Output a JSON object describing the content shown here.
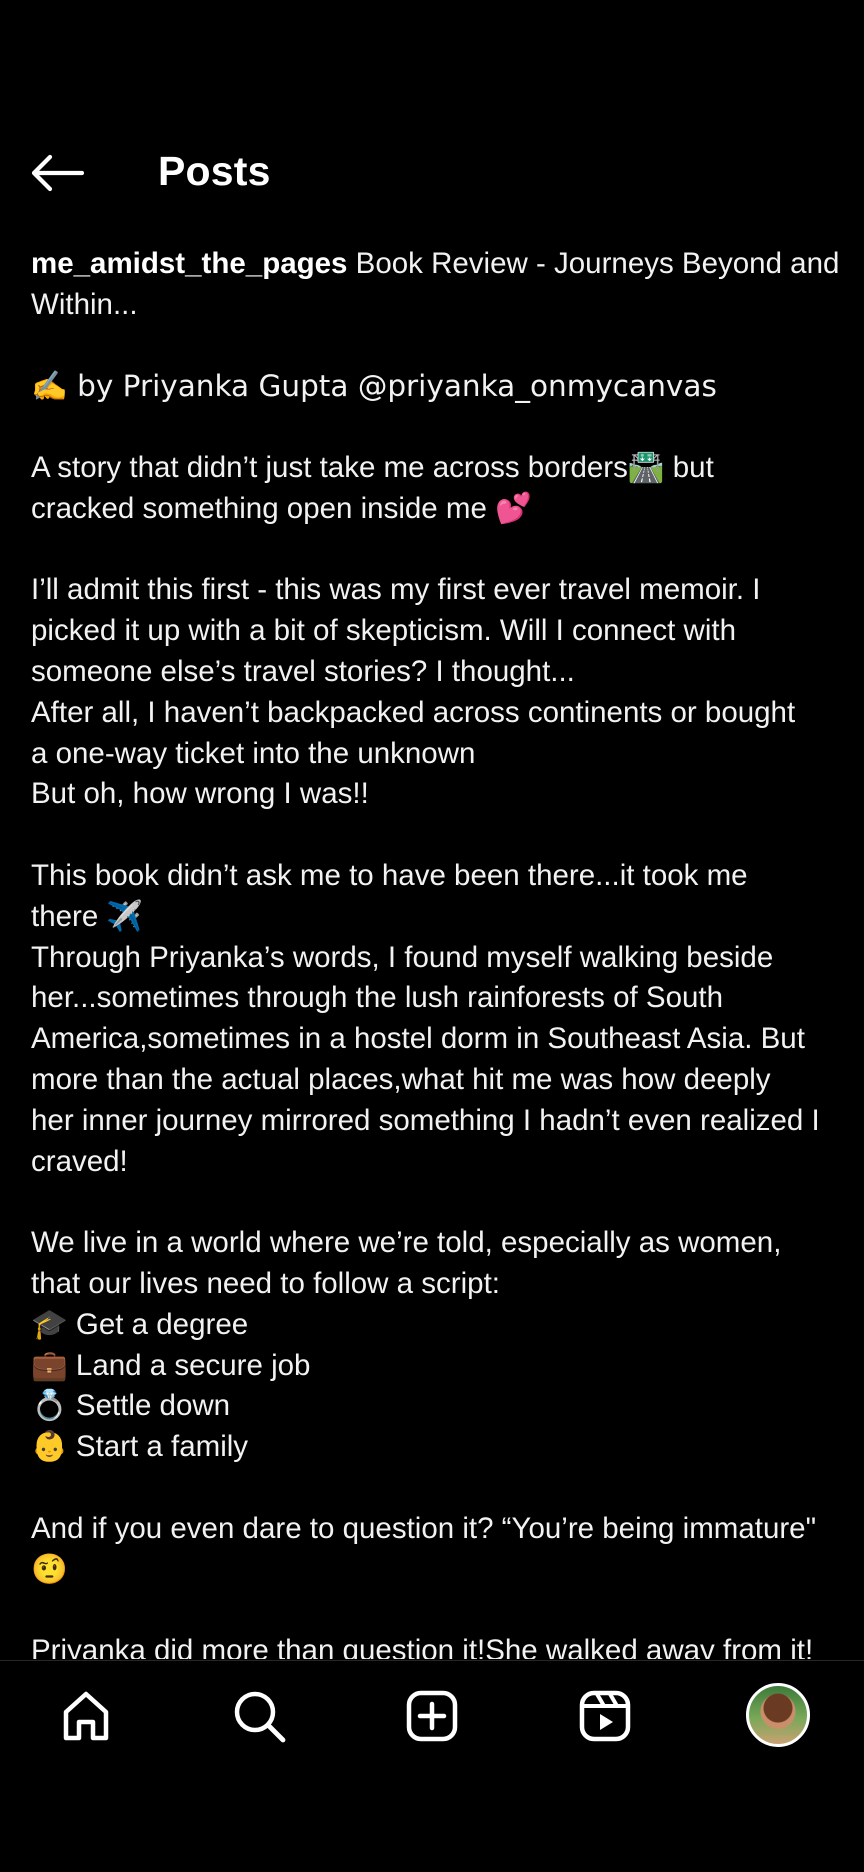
{
  "header": {
    "title": "Posts"
  },
  "post": {
    "username": "me_amidst_the_pages",
    "title_text": " Book Review - Journeys Beyond and Within...",
    "author_line": "✍️ by Priyanka Gupta @priyanka_onmycanvas",
    "para1_line1": "A story that didn’t just take me across borders🛣️ but",
    "para1_line2": "cracked something open inside me 💕",
    "para2_line1": "I’ll admit this first - this was my first ever travel memoir. I",
    "para2_line2": "picked it up with a bit of skepticism. Will I connect with",
    "para2_line3": "someone else’s travel stories? I thought...",
    "para2_line4": "After all, I haven’t backpacked across continents or bought",
    "para2_line5": "a one-way ticket into the unknown",
    "para2_line6": "But oh, how wrong I was!!",
    "para3_line1": "This book didn’t ask me to have been there...it took me",
    "para3_line2": "there ✈️",
    "para3_line3": "Through Priyanka’s words, I found myself walking beside",
    "para3_line4": "her...sometimes through the lush rainforests of South",
    "para3_line5": "America,sometimes in a hostel dorm in Southeast Asia. But",
    "para3_line6": "more than the actual places,what hit me was how deeply",
    "para3_line7": "her inner journey mirrored something I hadn’t even realized I",
    "para3_line8": "craved!",
    "para4_line1": "We live in a world where we’re told, especially as women,",
    "para4_line2": "that our lives need to follow a script:",
    "list_item1": "🎓 Get a degree",
    "list_item2": "💼 Land a secure job",
    "list_item3": "💍 Settle down",
    "list_item4": "👶 Start a family",
    "para5_line1": "And if you even dare to question it? “You’re being immature\"",
    "para5_line2": "🤨",
    "para6_line1": "Priyanka did more than question it!She walked away from it!"
  },
  "bottom_nav": {
    "items": [
      {
        "icon": "home-icon"
      },
      {
        "icon": "search-icon"
      },
      {
        "icon": "create-post-icon"
      },
      {
        "icon": "reels-icon"
      },
      {
        "icon": "profile-avatar"
      }
    ]
  },
  "colors": {
    "background": "#000000",
    "text": "#f2f2f2",
    "icon": "#ffffff"
  }
}
